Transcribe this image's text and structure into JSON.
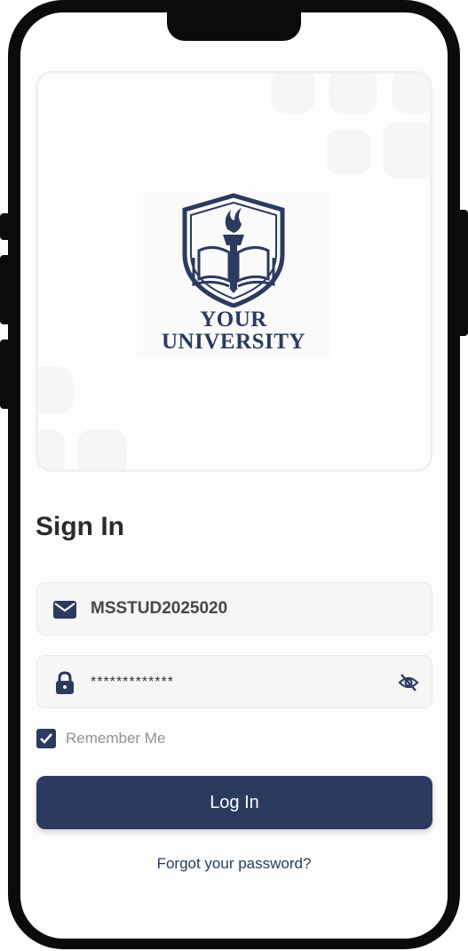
{
  "logo": {
    "line1": "YOUR",
    "line2": "UNIVERSITY",
    "icon": "torch-book-shield-icon"
  },
  "signin": {
    "title": "Sign In"
  },
  "form": {
    "username": {
      "value": "MSSTUD2025020",
      "icon": "envelope-icon"
    },
    "password": {
      "value": "*************",
      "icon": "lock-icon",
      "toggle_icon": "eye-slash-icon"
    },
    "remember": {
      "label": "Remember Me",
      "checked": true
    },
    "submit_label": "Log In",
    "forgot_label": "Forgot your password?"
  },
  "colors": {
    "primary": "#2c3a5f",
    "field_bg": "#f5f6f5",
    "muted_text": "#8f9194"
  }
}
